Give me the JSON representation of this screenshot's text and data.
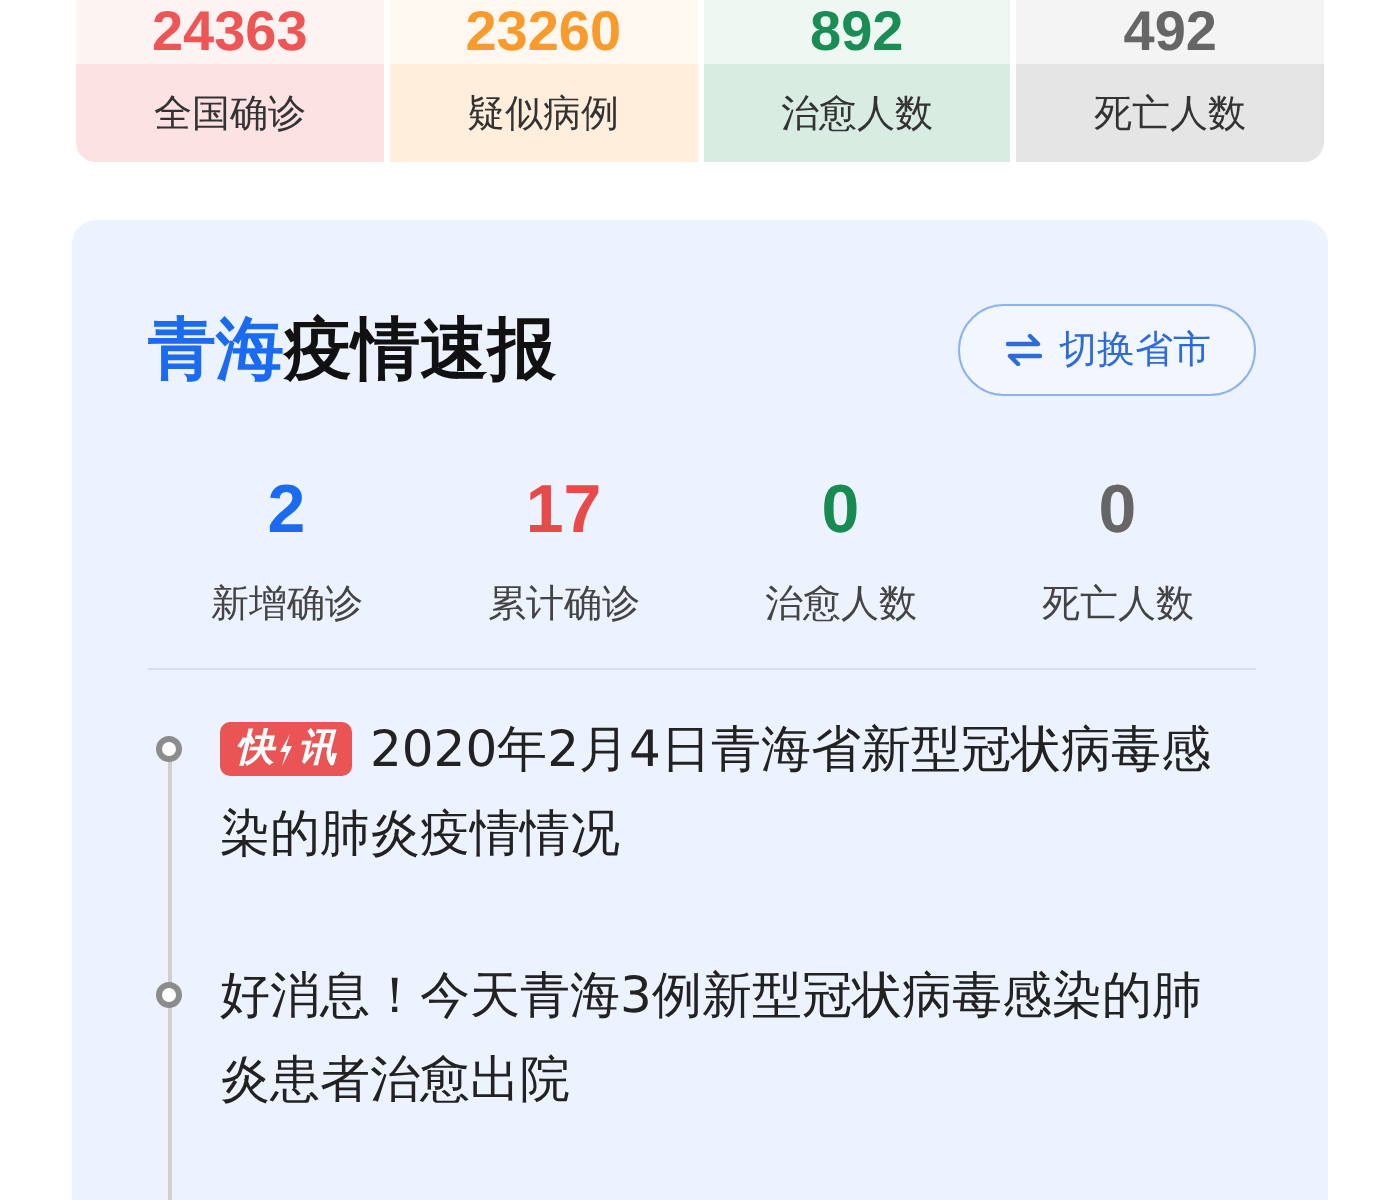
{
  "summary": [
    {
      "value": "24363",
      "label": "全国确诊",
      "color": "#ee5555"
    },
    {
      "value": "23260",
      "label": "疑似病例",
      "color": "#f89b2c"
    },
    {
      "value": "892",
      "label": "治愈人数",
      "color": "#1a8d55"
    },
    {
      "value": "492",
      "label": "死亡人数",
      "color": "#666666"
    }
  ],
  "panel": {
    "title_highlight": "青海",
    "title": "疫情速报",
    "switch_button": "切换省市",
    "stats": [
      {
        "value": "2",
        "label": "新增确诊",
        "color": "#1a6bf0"
      },
      {
        "value": "17",
        "label": "累计确诊",
        "color": "#e84a4a"
      },
      {
        "value": "0",
        "label": "治愈人数",
        "color": "#178b50"
      },
      {
        "value": "0",
        "label": "死亡人数",
        "color": "#666666"
      }
    ],
    "news": [
      {
        "badge": [
          "快",
          "讯"
        ],
        "text": "2020年2月4日青海省新型冠状病毒感染的肺炎疫情情况"
      },
      {
        "text": "好消息！今天青海3例新型冠状病毒感染的肺炎患者治愈出院"
      }
    ]
  }
}
